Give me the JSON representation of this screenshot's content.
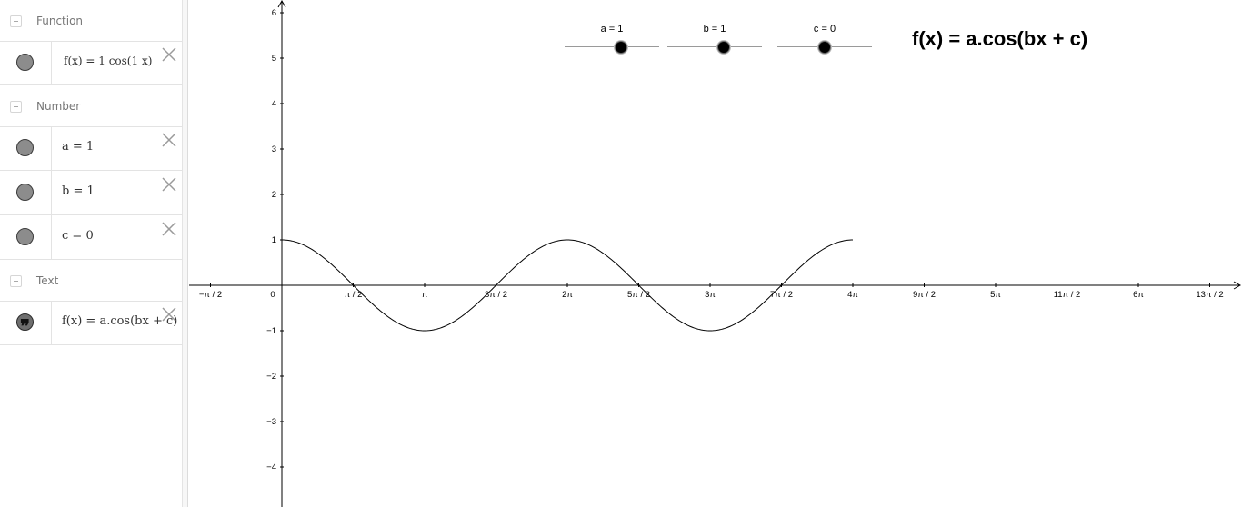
{
  "algebra": {
    "groups": [
      {
        "label": "Function",
        "items": [
          {
            "text": "f(x)  =  1  cos(1 x)",
            "icon": "point-marble"
          }
        ]
      },
      {
        "label": "Number",
        "items": [
          {
            "text": "a = 1",
            "icon": "point-marble"
          },
          {
            "text": "b = 1",
            "icon": "point-marble"
          },
          {
            "text": "c = 0",
            "icon": "point-marble"
          }
        ]
      },
      {
        "label": "Text",
        "items": [
          {
            "text": "f(x) = a.cos(bx + c)",
            "icon": "quote-marble"
          }
        ]
      }
    ],
    "delete_icon": "close-icon",
    "collapse_icon": "collapse-icon"
  },
  "graphics": {
    "sliders": [
      {
        "name": "a",
        "label": "a = 1",
        "value": 1,
        "min": -5,
        "max": 5
      },
      {
        "name": "b",
        "label": "b = 1",
        "value": 1,
        "min": -5,
        "max": 5
      },
      {
        "name": "c",
        "label": "c = 0",
        "value": 0,
        "min": -5,
        "max": 5
      }
    ],
    "text_object": "f(x) = a.cos(bx + c)"
  },
  "chart_data": {
    "type": "line",
    "function": "f(x) = 1 cos(1 x)",
    "x_ticks": [
      "−π / 2",
      "0",
      "π / 2",
      "π",
      "3π / 2",
      "2π",
      "5π / 2",
      "3π",
      "7π / 2",
      "4π",
      "9π / 2",
      "5π",
      "11π / 2",
      "6π",
      "13π / 2"
    ],
    "y_ticks": [
      "6",
      "5",
      "4",
      "3",
      "2",
      "1",
      "−1",
      "−2",
      "−3",
      "−4"
    ],
    "xlim": [
      -1.6,
      20.9
    ],
    "ylim": [
      -4.8,
      6.3
    ],
    "domain": [
      0,
      12.566
    ],
    "series": [
      {
        "x": [
          0,
          1.5708,
          3.1416,
          4.7124,
          6.2832,
          7.854,
          9.4248,
          10.9956,
          12.5664
        ],
        "y": [
          1,
          0,
          -1,
          0,
          1,
          0,
          -1,
          0,
          1
        ]
      }
    ],
    "grid": false
  }
}
